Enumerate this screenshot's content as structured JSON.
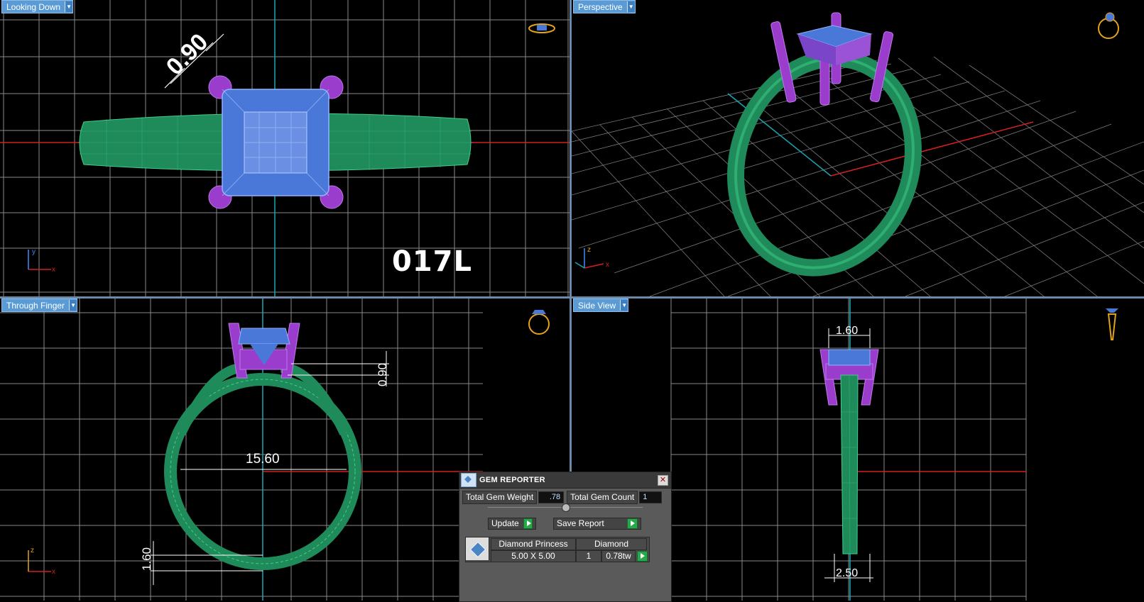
{
  "viewports": {
    "top_left": {
      "label": "Looking Down",
      "dimension": "0.90",
      "design_code": "017L",
      "axis_v": "y",
      "axis_h": "x"
    },
    "top_right": {
      "label": "Perspective",
      "axis_v": "z",
      "axis_h": "x"
    },
    "bottom_left": {
      "label": "Through Finger",
      "dim_top": "0.90",
      "dim_mid": "15.60",
      "dim_bottom": "1.60",
      "axis_v": "z",
      "axis_h": "x"
    },
    "bottom_right": {
      "label": "Side View",
      "dim_top": "1.60",
      "dim_bottom": "2.50"
    }
  },
  "gem_reporter": {
    "title": "GEM REPORTER",
    "close_glyph": "✕",
    "total_weight_label": "Total Gem Weight",
    "total_weight_value": ".78",
    "total_count_label": "Total Gem Count",
    "total_count_value": "1",
    "update_label": "Update",
    "save_report_label": "Save Report",
    "row": {
      "shape": "Diamond Princess",
      "material": "Diamond",
      "size": "5.00 X 5.00",
      "count": "1",
      "weight": "0.78tw"
    }
  },
  "colors": {
    "band": "#1f8a5a",
    "prong": "#9a3ccc",
    "gem": "#4a78d8",
    "grid": "#8a8a8a",
    "axis_red": "#d42020",
    "axis_cyan": "#1aa7b5",
    "icon_gold": "#e2a21a"
  },
  "icons": {
    "view_cube": "ring-icon"
  }
}
